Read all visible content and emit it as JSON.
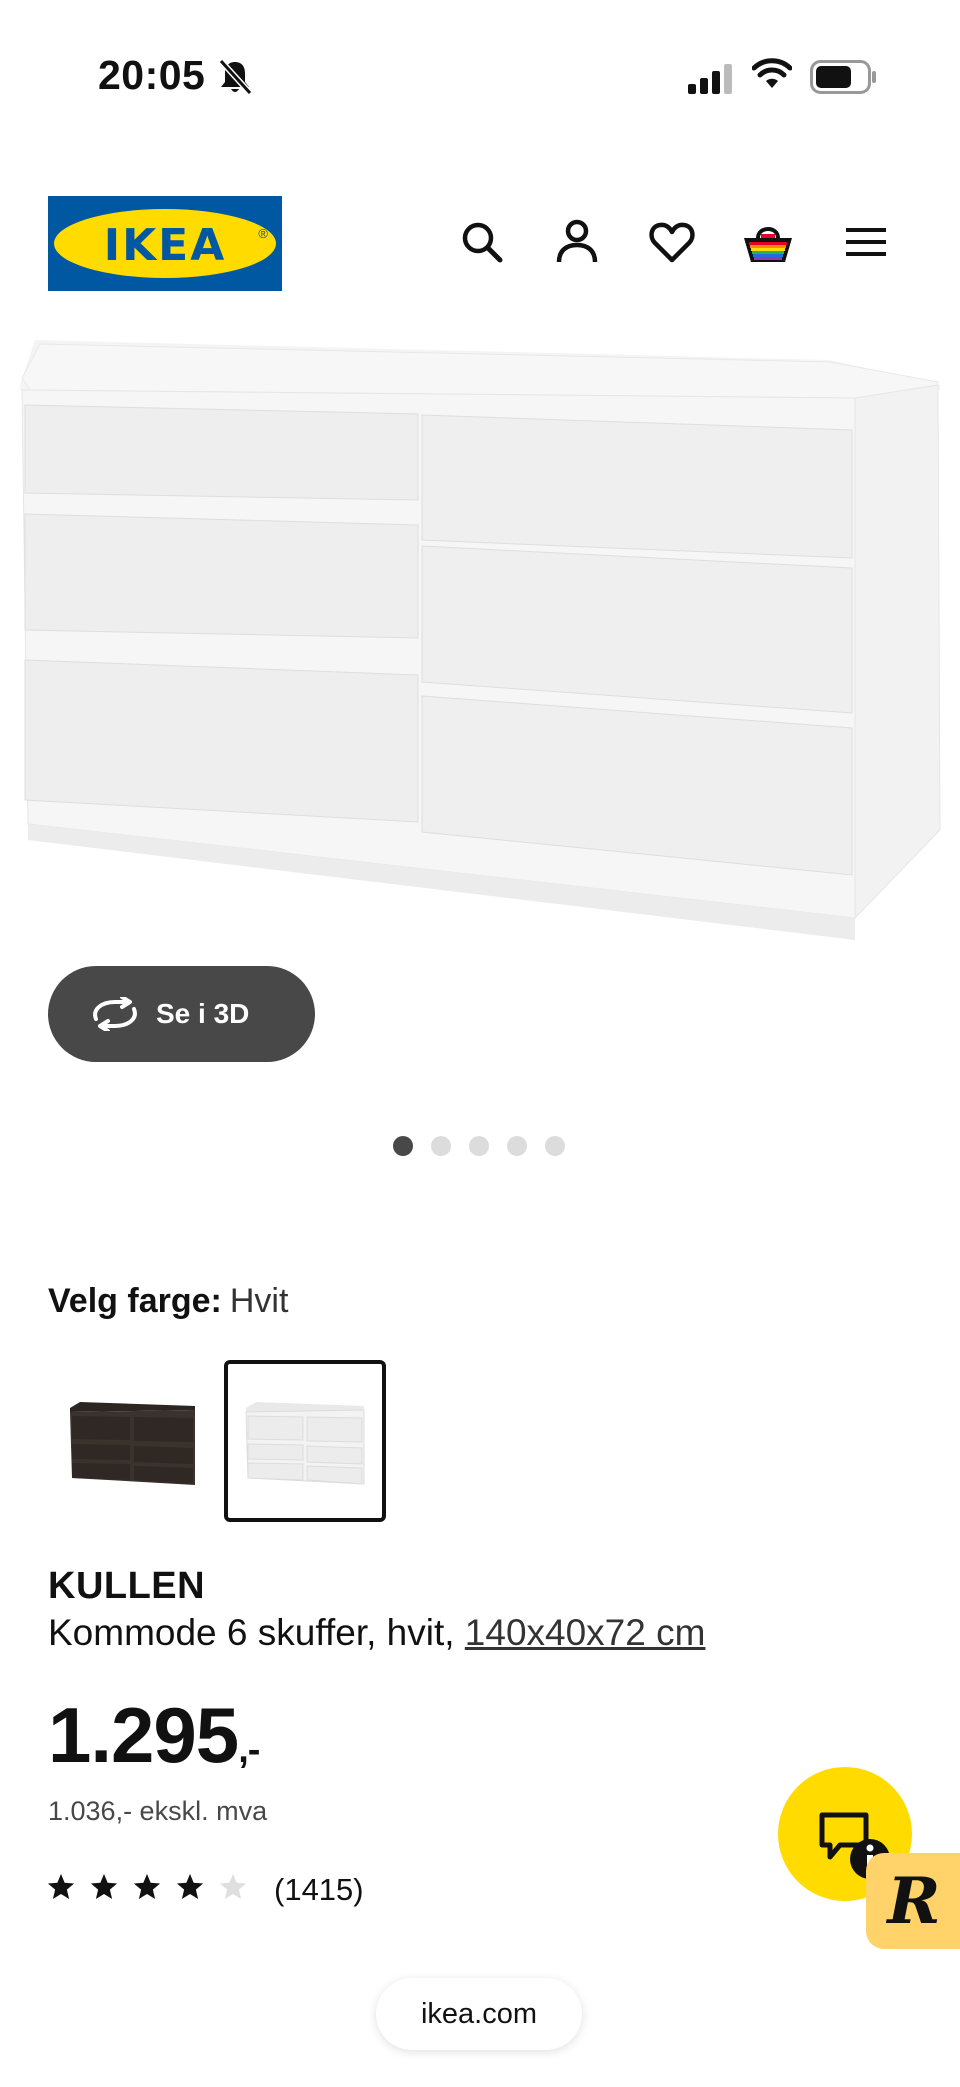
{
  "status_bar": {
    "time": "20:05"
  },
  "brand": {
    "logo_text": "IKEA"
  },
  "header": {
    "icons": [
      "search-icon",
      "account-icon",
      "heart-icon",
      "shopping-basket-icon",
      "menu-icon"
    ]
  },
  "gallery": {
    "view_3d_label": "Se i 3D",
    "dots_count": 5,
    "active_dot": 0
  },
  "color_selector": {
    "label": "Velg farge:",
    "value": "Hvit",
    "options": [
      "black-brown",
      "white"
    ],
    "selected": "white"
  },
  "product": {
    "name": "KULLEN",
    "description": "Kommode 6 skuffer, hvit,",
    "dimensions": "140x40x72 cm",
    "price_main": "1.295",
    "price_suffix": ",-",
    "price_ex_vat": "1.036,- ekskl. mva",
    "rating": 4,
    "rating_max": 5,
    "review_count": "(1415)"
  },
  "browser": {
    "url": "ikea.com"
  },
  "colors": {
    "ikea_blue": "#0058a3",
    "ikea_yellow": "#ffdb00",
    "button_dark": "#484848"
  }
}
